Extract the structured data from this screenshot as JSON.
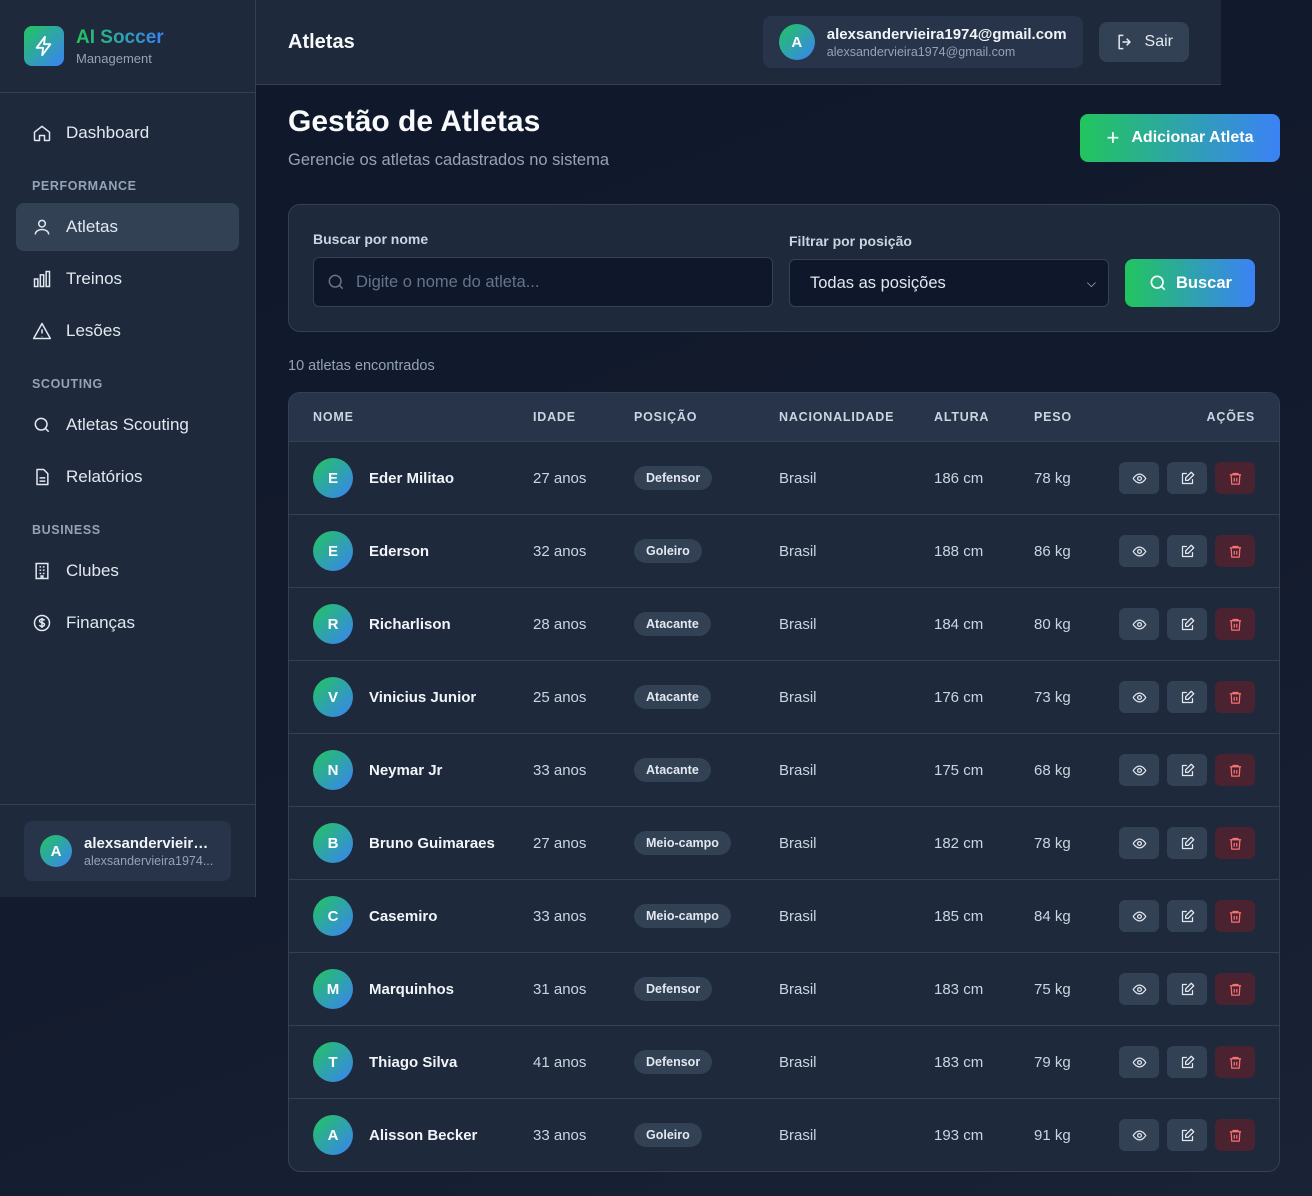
{
  "brand": {
    "title": "AI Soccer",
    "subtitle": "Management"
  },
  "sidebar": {
    "items": [
      {
        "label": "Dashboard",
        "icon": "home-icon"
      },
      {
        "section": "PERFORMANCE"
      },
      {
        "label": "Atletas",
        "icon": "user-icon",
        "active": true
      },
      {
        "label": "Treinos",
        "icon": "bar-chart-icon"
      },
      {
        "label": "Lesões",
        "icon": "warning-icon"
      },
      {
        "section": "SCOUTING"
      },
      {
        "label": "Atletas Scouting",
        "icon": "search-icon"
      },
      {
        "label": "Relatórios",
        "icon": "document-icon"
      },
      {
        "section": "BUSINESS"
      },
      {
        "label": "Clubes",
        "icon": "building-icon"
      },
      {
        "label": "Finanças",
        "icon": "dollar-icon"
      }
    ],
    "user": {
      "initial": "A",
      "name": "alexsandervieira1...",
      "email": "alexsandervieira1974..."
    }
  },
  "header": {
    "title": "Atletas",
    "user": {
      "initial": "A",
      "name": "alexsandervieira1974@gmail.com",
      "email": "alexsandervieira1974@gmail.com"
    },
    "logout_label": "Sair"
  },
  "main": {
    "title": "Gestão de Atletas",
    "subtitle": "Gerencie os atletas cadastrados no sistema",
    "add_label": "Adicionar Atleta",
    "filters": {
      "search_label": "Buscar por nome",
      "search_placeholder": "Digite o nome do atleta...",
      "search_value": "",
      "position_label": "Filtrar por posição",
      "position_selected": "Todas as posições",
      "search_button": "Buscar"
    },
    "count_text": "10 atletas encontrados",
    "table": {
      "columns": [
        "NOME",
        "IDADE",
        "POSIÇÃO",
        "NACIONALIDADE",
        "ALTURA",
        "PESO",
        "AÇÕES"
      ],
      "rows": [
        {
          "initial": "E",
          "name": "Eder Militao",
          "age": "27 anos",
          "position": "Defensor",
          "nationality": "Brasil",
          "height": "186 cm",
          "weight": "78 kg"
        },
        {
          "initial": "E",
          "name": "Ederson",
          "age": "32 anos",
          "position": "Goleiro",
          "nationality": "Brasil",
          "height": "188 cm",
          "weight": "86 kg"
        },
        {
          "initial": "R",
          "name": "Richarlison",
          "age": "28 anos",
          "position": "Atacante",
          "nationality": "Brasil",
          "height": "184 cm",
          "weight": "80 kg"
        },
        {
          "initial": "V",
          "name": "Vinicius Junior",
          "age": "25 anos",
          "position": "Atacante",
          "nationality": "Brasil",
          "height": "176 cm",
          "weight": "73 kg"
        },
        {
          "initial": "N",
          "name": "Neymar Jr",
          "age": "33 anos",
          "position": "Atacante",
          "nationality": "Brasil",
          "height": "175 cm",
          "weight": "68 kg"
        },
        {
          "initial": "B",
          "name": "Bruno Guimaraes",
          "age": "27 anos",
          "position": "Meio-campo",
          "nationality": "Brasil",
          "height": "182 cm",
          "weight": "78 kg"
        },
        {
          "initial": "C",
          "name": "Casemiro",
          "age": "33 anos",
          "position": "Meio-campo",
          "nationality": "Brasil",
          "height": "185 cm",
          "weight": "84 kg"
        },
        {
          "initial": "M",
          "name": "Marquinhos",
          "age": "31 anos",
          "position": "Defensor",
          "nationality": "Brasil",
          "height": "183 cm",
          "weight": "75 kg"
        },
        {
          "initial": "T",
          "name": "Thiago Silva",
          "age": "41 anos",
          "position": "Defensor",
          "nationality": "Brasil",
          "height": "183 cm",
          "weight": "79 kg"
        },
        {
          "initial": "A",
          "name": "Alisson Becker",
          "age": "33 anos",
          "position": "Goleiro",
          "nationality": "Brasil",
          "height": "193 cm",
          "weight": "91 kg"
        }
      ]
    }
  },
  "colors": {
    "accent_green": "#22c55e",
    "accent_blue": "#3b82f6",
    "danger": "#f87171",
    "surface": "#1e293b"
  }
}
